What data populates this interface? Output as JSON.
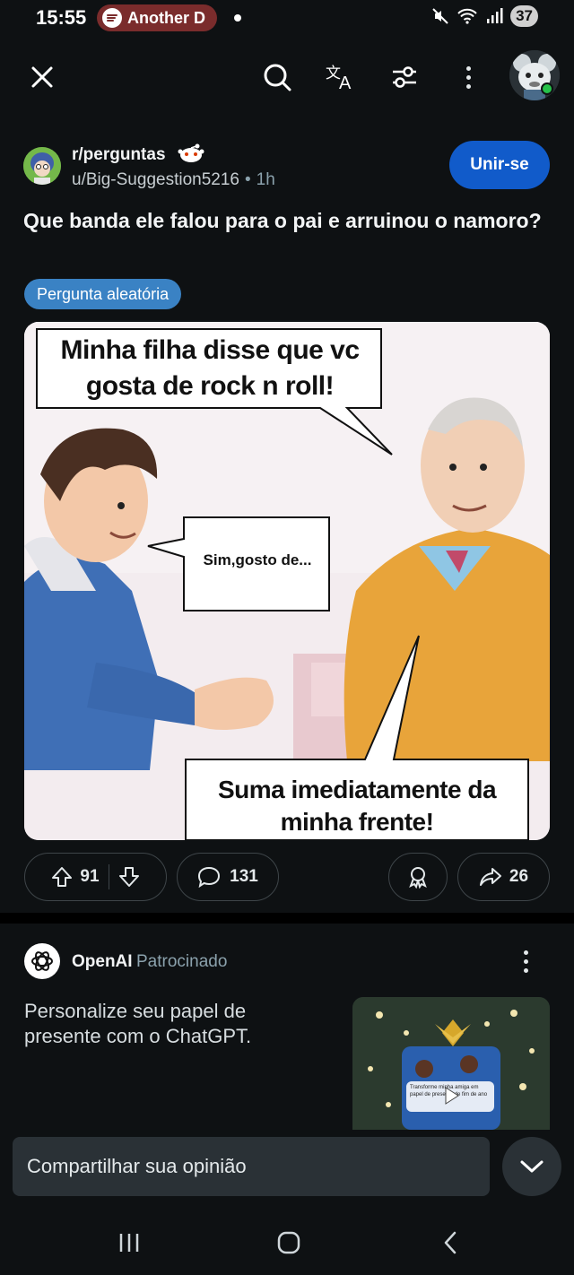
{
  "status_bar": {
    "time": "15:55",
    "media_chip": "Another D",
    "battery": "37",
    "icons": [
      "mute-icon",
      "wifi-icon",
      "signal-icon"
    ]
  },
  "topnav": {
    "icons": [
      "close-icon",
      "search-icon",
      "translate-icon",
      "filter-icon",
      "more-icon"
    ]
  },
  "post": {
    "subreddit": "r/perguntas",
    "author": "u/Big-Suggestion5216",
    "separator": "•",
    "age": "1h",
    "join_label": "Unir-se",
    "title": "Que banda ele falou para o pai e arruinou o namoro?",
    "flair": "Pergunta aleatória",
    "meme": {
      "bubble_top": "Minha filha disse que vc gosta de rock n roll!",
      "bubble_middle": "Sim,gosto de...",
      "bubble_bottom": "Suma imediatamente da minha frente!"
    },
    "votes": "91",
    "comments": "131",
    "shares": "26"
  },
  "ad": {
    "advertiser": "OpenAI",
    "sponsored_label": "Patrocinado",
    "text": "Personalize seu papel de presente com o ChatGPT.",
    "thumbnail_caption": "Transforme minha amiga em papel de presente de fim de ano"
  },
  "share_bar": {
    "placeholder": "Compartilhar sua opinião"
  },
  "colors": {
    "background": "#0e1113",
    "join_button": "#115bca",
    "flair": "#3a82c4",
    "spotify_chip": "#7a2c2c"
  }
}
